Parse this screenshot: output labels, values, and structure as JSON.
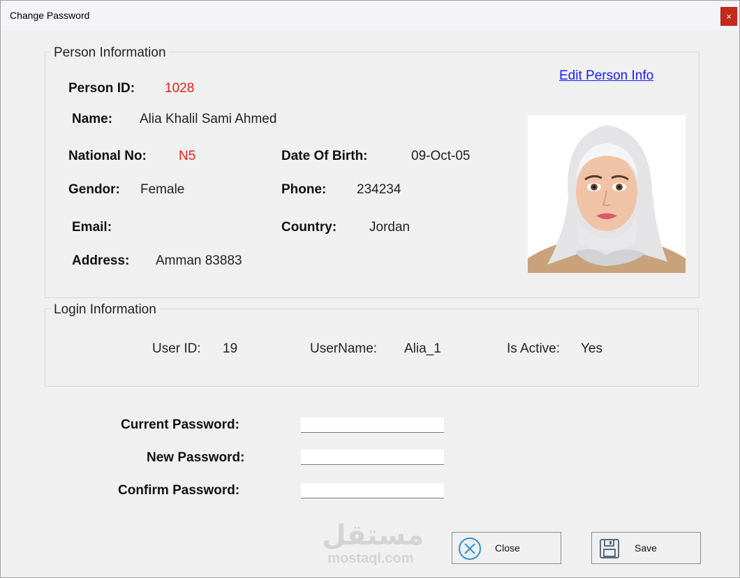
{
  "window": {
    "title": "Change Password",
    "close_glyph": "×"
  },
  "person_info": {
    "legend": "Person Information",
    "edit_link": "Edit Person Info",
    "person_id_label": "Person ID:",
    "person_id_value": "1028",
    "name_label": "Name:",
    "name_value": "Alia Khalil Sami Ahmed",
    "national_no_label": "National No:",
    "national_no_value": "N5",
    "dob_label": "Date Of Birth:",
    "dob_value": "09-Oct-05",
    "gender_label": "Gendor:",
    "gender_value": "Female",
    "phone_label": "Phone:",
    "phone_value": "234234",
    "email_label": "Email:",
    "email_value": "",
    "country_label": "Country:",
    "country_value": "Jordan",
    "address_label": "Address:",
    "address_value": "Amman 83883"
  },
  "login_info": {
    "legend": "Login Information",
    "user_id_label": "User ID:",
    "user_id_value": "19",
    "username_label": "UserName:",
    "username_value": "Alia_1",
    "is_active_label": "Is Active:",
    "is_active_value": "Yes"
  },
  "password_form": {
    "current_label": "Current Password:",
    "current_value": "",
    "new_label": "New Password:",
    "new_value": "",
    "confirm_label": "Confirm Password:",
    "confirm_value": ""
  },
  "buttons": {
    "close_label": "Close",
    "save_label": "Save"
  },
  "watermark": {
    "arabic": "مستقل",
    "latin": "mostaql.com"
  },
  "colors": {
    "accent_red": "#ee1c1c",
    "link_blue": "#1a1aff",
    "close_button_red": "#c42b1c"
  }
}
